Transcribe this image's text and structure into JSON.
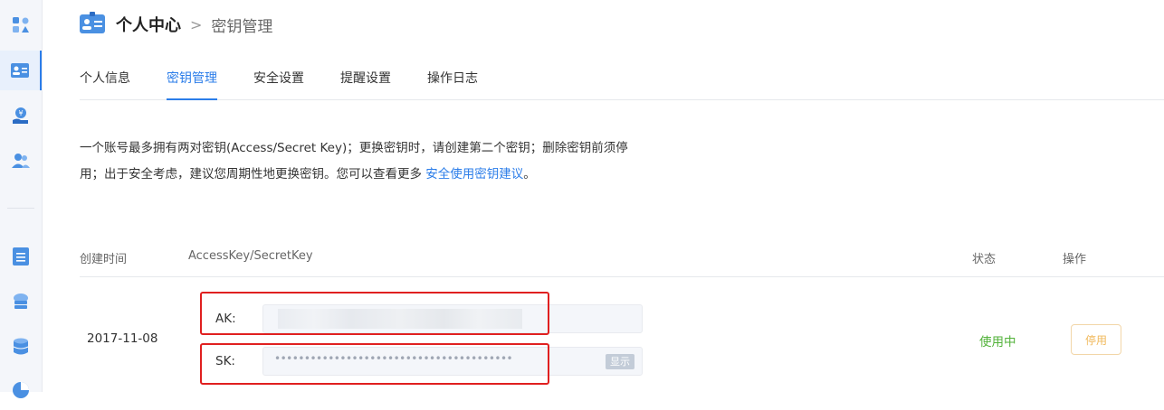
{
  "header": {
    "title": "个人中心",
    "separator": ">",
    "crumb": "密钥管理"
  },
  "tabs": [
    {
      "label": "个人信息"
    },
    {
      "label": "密钥管理",
      "active": true
    },
    {
      "label": "安全设置"
    },
    {
      "label": "提醒设置"
    },
    {
      "label": "操作日志"
    }
  ],
  "description": {
    "line1": "一个账号最多拥有两对密钥(Access/Secret Key)；更换密钥时，请创建第二个密钥；删除密钥前须停",
    "line2": "用；出于安全考虑，建议您周期性地更换密钥。您可以查看更多 ",
    "link": "安全使用密钥建议",
    "tail": "。"
  },
  "table": {
    "headers": {
      "created": "创建时间",
      "keys": "AccessKey/SecretKey",
      "status": "状态",
      "action": "操作"
    },
    "rows": [
      {
        "created": "2017-11-08",
        "ak_label": "AK:",
        "sk_label": "SK:",
        "sk_masked": "••••••••••••••••••••••••••••••••••••••••",
        "show_label": "显示",
        "status": "使用中",
        "action_label": "停用"
      }
    ]
  },
  "colors": {
    "accent": "#2b7de9",
    "status_active": "#52b23a",
    "disable_button": "#f0b85a",
    "highlight": "#e02020"
  },
  "sidebar_icons": [
    "apps-icon",
    "id-card-icon",
    "hand-yuan-icon",
    "users-icon",
    "document-list-icon",
    "cloud-server-icon",
    "database-icon",
    "pie-chart-icon"
  ]
}
